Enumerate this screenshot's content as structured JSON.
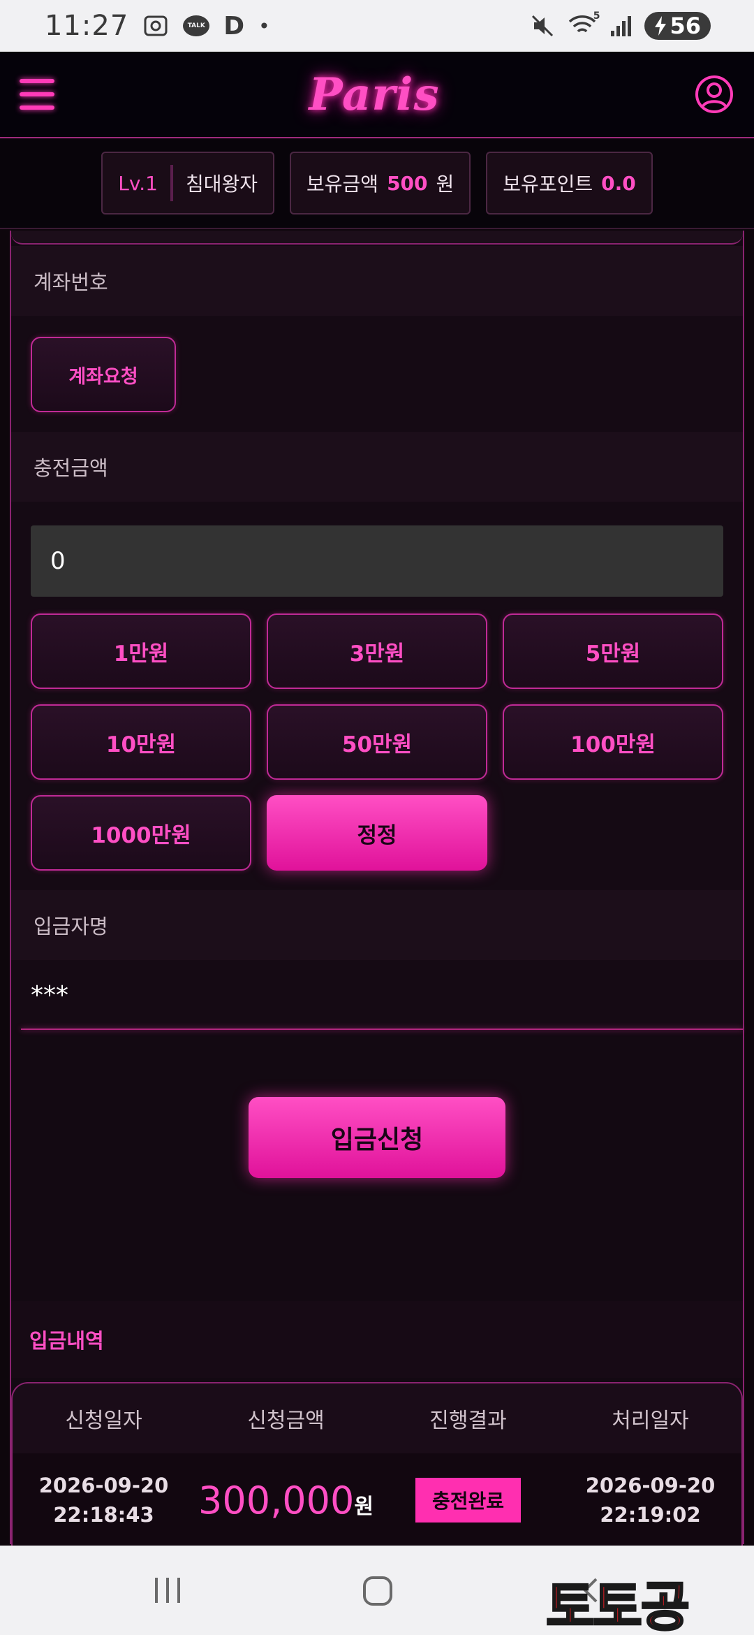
{
  "status_bar": {
    "time": "11:27",
    "talk_icon_text": "TALK",
    "letter": "D",
    "dot": "•",
    "wifi_label": "5",
    "battery": "56"
  },
  "header": {
    "logo": "Paris"
  },
  "user_info": {
    "level": "Lv.1",
    "nickname": "침대왕자",
    "balance_label": "보유금액",
    "balance_value": "500",
    "balance_unit": "원",
    "points_label": "보유포인트",
    "points_value": "0.0"
  },
  "form": {
    "account_label": "계좌번호",
    "account_request_button": "계좌요청",
    "amount_label": "충전금액",
    "amount_value": "0",
    "amount_buttons": [
      "1만원",
      "3만원",
      "5만원",
      "10만원",
      "50만원",
      "100만원",
      "1000만원"
    ],
    "reset_button": "정정",
    "depositor_label": "입금자명",
    "depositor_value": "***",
    "submit_button": "입금신청"
  },
  "history": {
    "title": "입금내역",
    "columns": [
      "신청일자",
      "신청금액",
      "진행결과",
      "처리일자"
    ],
    "rows": [
      {
        "request_date": "2026-09-20",
        "request_time": "22:18:43",
        "amount": "300,000",
        "amount_unit": "원",
        "status": "충전완료",
        "processed_date": "2026-09-20",
        "processed_time": "22:19:02"
      }
    ]
  },
  "watermark": "토토공",
  "colors": {
    "accent": "#ff2fb0",
    "background": "#130912",
    "input_bg": "#333333"
  }
}
